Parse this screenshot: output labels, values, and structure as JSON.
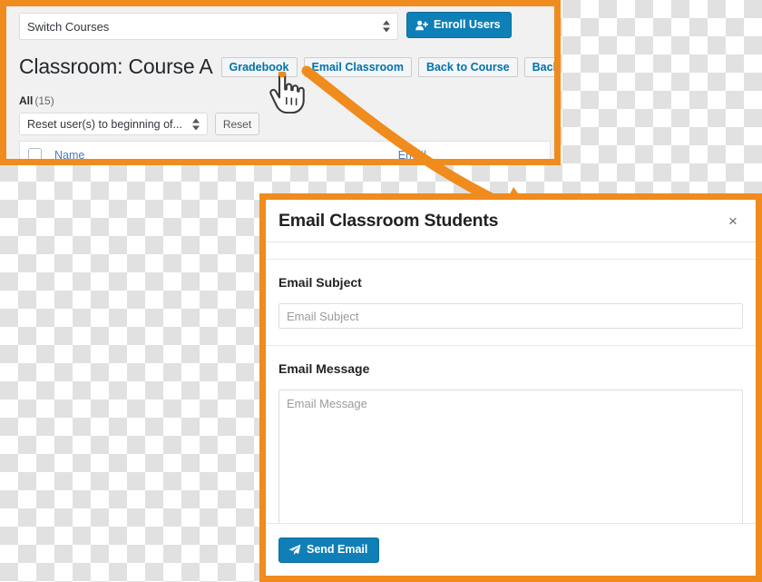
{
  "top_panel": {
    "switch_courses": {
      "value": "Switch Courses",
      "icon": "select-updown-icon"
    },
    "enroll_users_button": {
      "label": "Enroll Users",
      "icon": "user-plus-icon"
    },
    "page_title": "Classroom: Course A",
    "title_actions": [
      {
        "label": "Gradebook",
        "name": "gradebook"
      },
      {
        "label": "Email Classroom",
        "name": "email-classroom"
      },
      {
        "label": "Back to Course",
        "name": "back-to-course"
      },
      {
        "label": "Back to Courses",
        "name": "back-to-courses"
      }
    ],
    "filter": {
      "all_label": "All",
      "all_count": "(15)"
    },
    "reset_select": {
      "value": "Reset user(s) to beginning of...",
      "icon": "select-updown-icon"
    },
    "reset_button": {
      "label": "Reset"
    },
    "table": {
      "columns": {
        "name": "Name",
        "email": "Email"
      }
    }
  },
  "annotations": {
    "cursor_icon": "pointing-hand-cursor-icon",
    "arrow_icon": "curved-arrow-icon",
    "highlight_color": "#f08b1d"
  },
  "modal": {
    "title": "Email Classroom Students",
    "close_label": "×",
    "close_icon": "close-icon",
    "subject": {
      "label": "Email Subject",
      "placeholder": "Email Subject",
      "value": ""
    },
    "message": {
      "label": "Email Message",
      "placeholder": "Email Message",
      "value": ""
    },
    "send_button": {
      "label": "Send Email",
      "icon": "paper-plane-icon"
    }
  },
  "colors": {
    "highlight_orange": "#f08b1d",
    "primary_blue": "#0f80b7",
    "link_blue": "#0073aa",
    "panel_gray": "#f1f1f1"
  }
}
